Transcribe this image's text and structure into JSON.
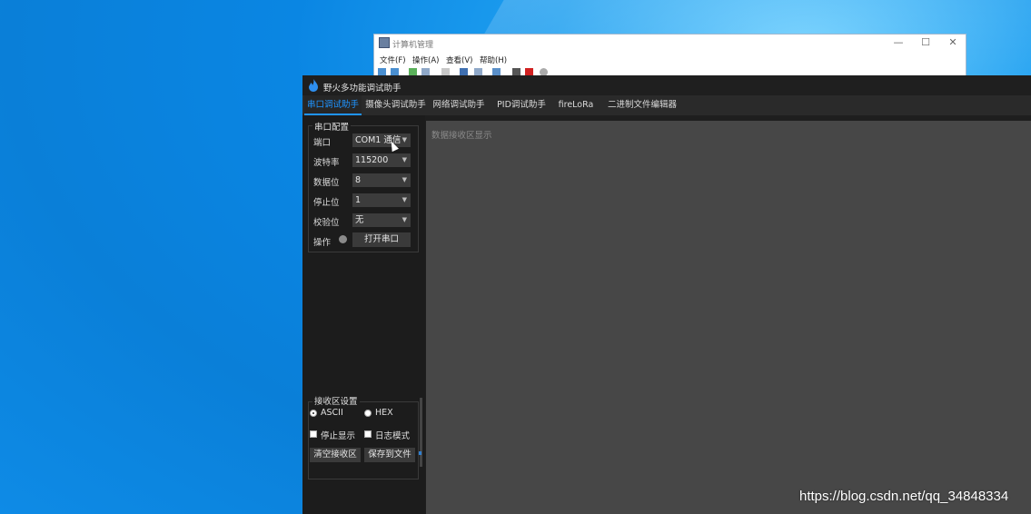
{
  "background_window": {
    "title": "计算机管理",
    "controls": {
      "minimize": "—",
      "maximize": "☐",
      "close": "✕"
    },
    "menu": [
      "文件(F)",
      "操作(A)",
      "查看(V)",
      "帮助(H)"
    ]
  },
  "app": {
    "title": "野火多功能调试助手",
    "tabs": [
      "串口调试助手",
      "摄像头调试助手",
      "网络调试助手",
      "PID调试助手",
      "fireLoRa",
      "二进制文件编辑器"
    ],
    "active_tab": "串口调试助手",
    "serial_config": {
      "title": "串口配置",
      "fields": [
        {
          "label": "端口",
          "value": "COM1 通信"
        },
        {
          "label": "波特率",
          "value": "115200"
        },
        {
          "label": "数据位",
          "value": "8"
        },
        {
          "label": "停止位",
          "value": "1"
        },
        {
          "label": "校验位",
          "value": "无"
        }
      ],
      "operation_label": "操作",
      "open_button": "打开串口"
    },
    "receive_settings": {
      "title": "接收区设置",
      "radio_ascii": "ASCII",
      "radio_hex": "HEX",
      "selected_mode": "ASCII",
      "check_stop_display": "停止显示",
      "check_log_mode": "日志模式",
      "clear_button": "清空接收区",
      "save_button": "保存到文件"
    },
    "receive_area": {
      "placeholder": "数据接收区显示"
    }
  },
  "watermark": "https://blog.csdn.net/qq_34848334",
  "colors": {
    "accent": "#1f94ff",
    "desktop": "#0a86e3",
    "panel": "#1c1c1c",
    "receive_area": "#474747"
  }
}
